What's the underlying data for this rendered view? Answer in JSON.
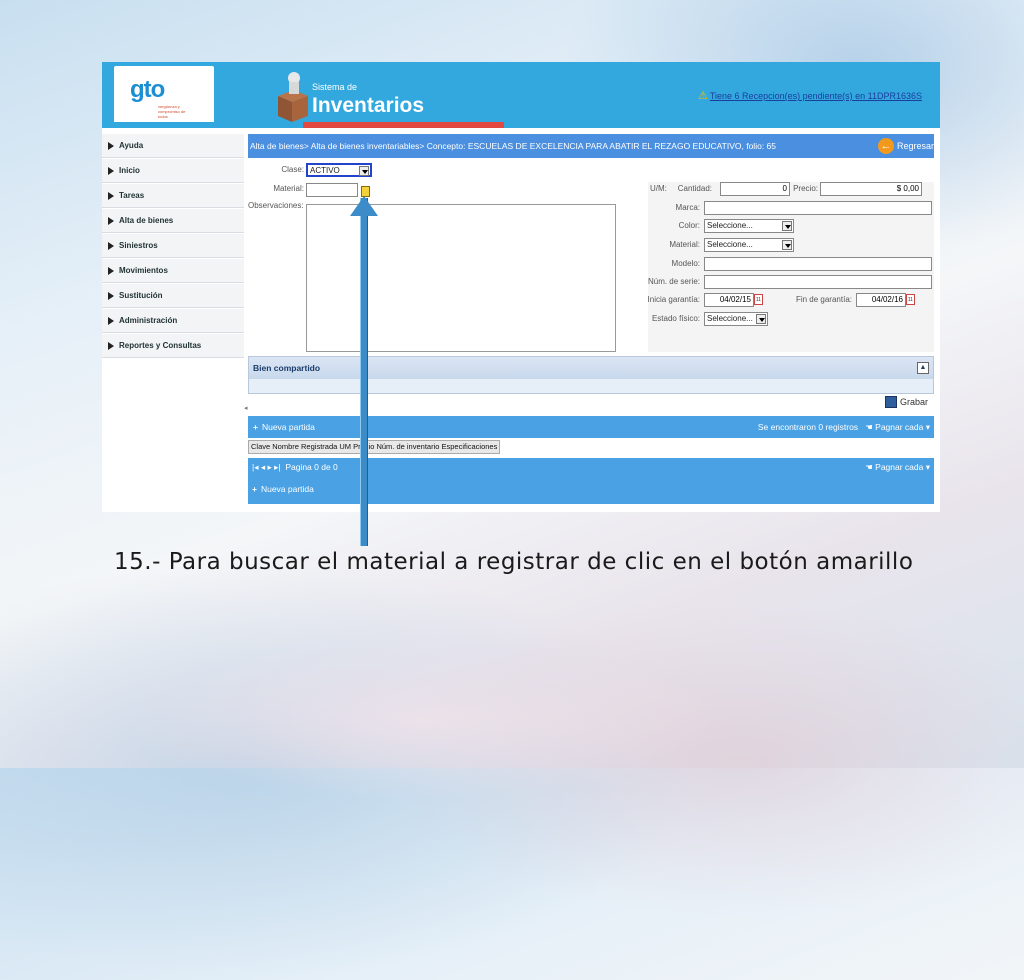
{
  "header": {
    "logo_text": "gto",
    "logo_sub": "vergüenza y compromiso de todos",
    "secretaria": "Secretaría de Educación",
    "sistema": "Sistema de",
    "app_title": "Inventarios",
    "alert_link": "Tiene 6 Recepcion(es) pendiente(s) en 11DPR1636S"
  },
  "sidebar": {
    "items": [
      {
        "label": "Ayuda"
      },
      {
        "label": "Inicio"
      },
      {
        "label": "Tareas"
      },
      {
        "label": "Alta de bienes"
      },
      {
        "label": "Siniestros"
      },
      {
        "label": "Movimientos"
      },
      {
        "label": "Sustitución"
      },
      {
        "label": "Administración"
      },
      {
        "label": "Reportes y Consultas"
      }
    ]
  },
  "main": {
    "breadcrumb": "Alta de bienes> Alta de bienes inventariables> Concepto: ESCUELAS DE EXCELENCIA PARA ABATIR EL REZAGO EDUCATIVO, folio: 65",
    "back_label": "Regresar",
    "form": {
      "clase_label": "Clase:",
      "clase_value": "ACTIVO",
      "material_label": "Material:",
      "observaciones_label": "Observaciones:",
      "um_label": "U/M:",
      "cantidad_label": "Cantidad:",
      "cantidad_value": "0",
      "precio_label": "Precio:",
      "precio_value": "$ 0,00",
      "marca_label": "Marca:",
      "color_label": "Color:",
      "color_value": "Seleccione...",
      "material2_label": "Material:",
      "material2_value": "Seleccione...",
      "modelo_label": "Modelo:",
      "serie_label": "Núm. de serie:",
      "inicia_label": "Inicia garantía:",
      "inicia_value": "04/02/15",
      "fin_label": "Fin de garantía:",
      "fin_value": "04/02/16",
      "estado_label": "Estado físico:",
      "estado_value": "Seleccione..."
    },
    "shared_title": "Bien compartido",
    "save_label": "Grabar",
    "new_item_label": "Nueva partida",
    "found_label": "Se encontraron  0  registros",
    "paginate_label": "Pagnar cada",
    "grid_headers": "Clave Nombre Registrada UM Precio Núm. de inventario Especificaciones",
    "pager_label": "Pagina  0 de  0",
    "pager_paginate_label": "Pagnar cada",
    "pager_new_item_label": "Nueva partida"
  },
  "caption": "15.- Para buscar el material a registrar de clic en el botón amarillo",
  "colors": {
    "header_blue": "#33a8df",
    "bar_blue": "#4aa1e4",
    "accent_red": "#e2483d",
    "arrow_blue": "#3b8cc8"
  }
}
